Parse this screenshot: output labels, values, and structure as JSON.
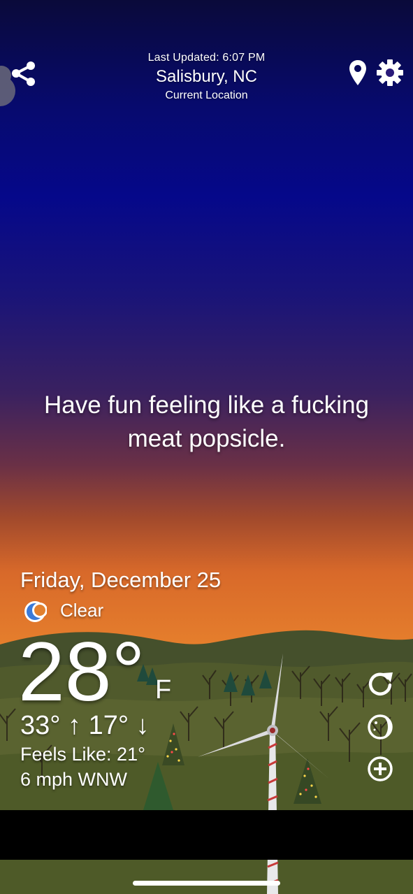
{
  "header": {
    "last_updated": "Last Updated: 6:07 PM",
    "city": "Salisbury, NC",
    "location_label": "Current Location"
  },
  "icons": {
    "share": "share-icon",
    "location": "location-pin-icon",
    "settings": "gear-icon",
    "refresh": "refresh-icon",
    "moon_phase": "moon-phase-icon",
    "add": "add-circle-icon",
    "condition": "crescent-moon-icon"
  },
  "message": "Have fun feeling like a fucking meat popsicle.",
  "weather": {
    "date": "Friday, December 25",
    "condition": "Clear",
    "temperature": "28°",
    "unit": "F",
    "high_low": "33° ↑  17° ↓",
    "feels_like": "Feels Like: 21°",
    "wind": "6 mph WNW"
  },
  "colors": {
    "sky_top": "#0a0a3a",
    "sky_mid": "#05088a",
    "sky_horizon": "#e88a33",
    "hills": "#3d4a26",
    "moon_icon": "#3a7ad8"
  }
}
